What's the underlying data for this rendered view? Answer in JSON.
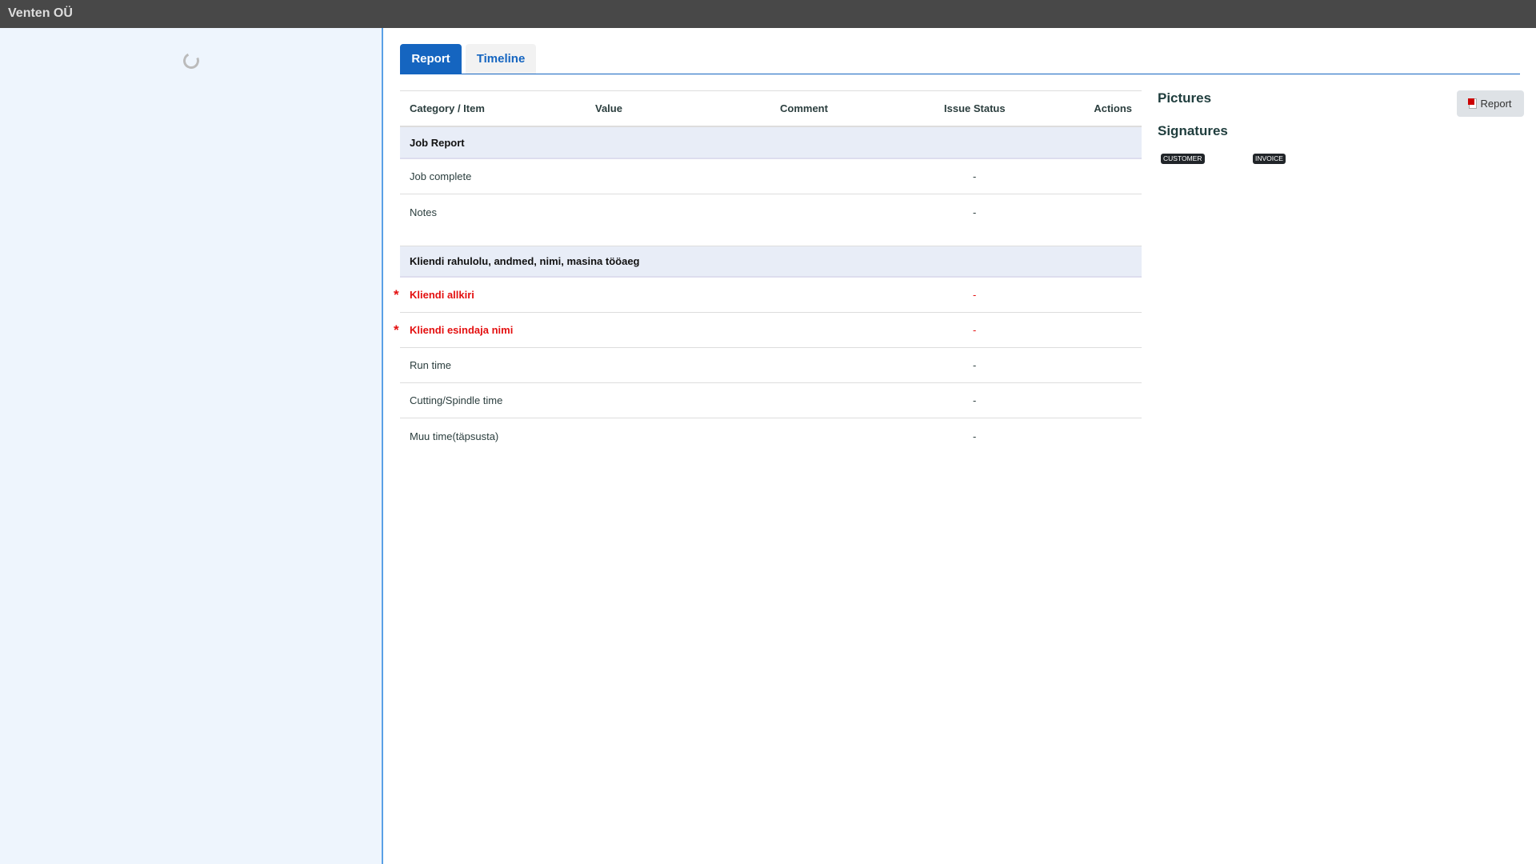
{
  "header": {
    "title": "Venten OÜ"
  },
  "tabs": [
    {
      "label": "Report",
      "active": true
    },
    {
      "label": "Timeline",
      "active": false
    }
  ],
  "table": {
    "columns": [
      "Category / Item",
      "Value",
      "Comment",
      "Issue Status",
      "Actions"
    ],
    "sections": [
      {
        "title": "Job Report",
        "items": [
          {
            "label": "Job complete",
            "status": "-",
            "required": false
          },
          {
            "label": "Notes",
            "status": "-",
            "required": false
          }
        ]
      },
      {
        "title": "Kliendi rahulolu, andmed, nimi, masina tööaeg",
        "items": [
          {
            "label": "Kliendi allkiri",
            "status": "-",
            "required": true
          },
          {
            "label": "Kliendi esindaja nimi",
            "status": "-",
            "required": true
          },
          {
            "label": "Run time",
            "status": "-",
            "required": false
          },
          {
            "label": "Cutting/Spindle time",
            "status": "-",
            "required": false
          },
          {
            "label": "Muu time(täpsusta)",
            "status": "-",
            "required": false
          }
        ]
      }
    ]
  },
  "right": {
    "pictures_title": "Pictures",
    "signatures_title": "Signatures",
    "badges": [
      "CUSTOMER",
      "INVOICE"
    ],
    "report_button": "Report"
  },
  "required_marker": "*"
}
